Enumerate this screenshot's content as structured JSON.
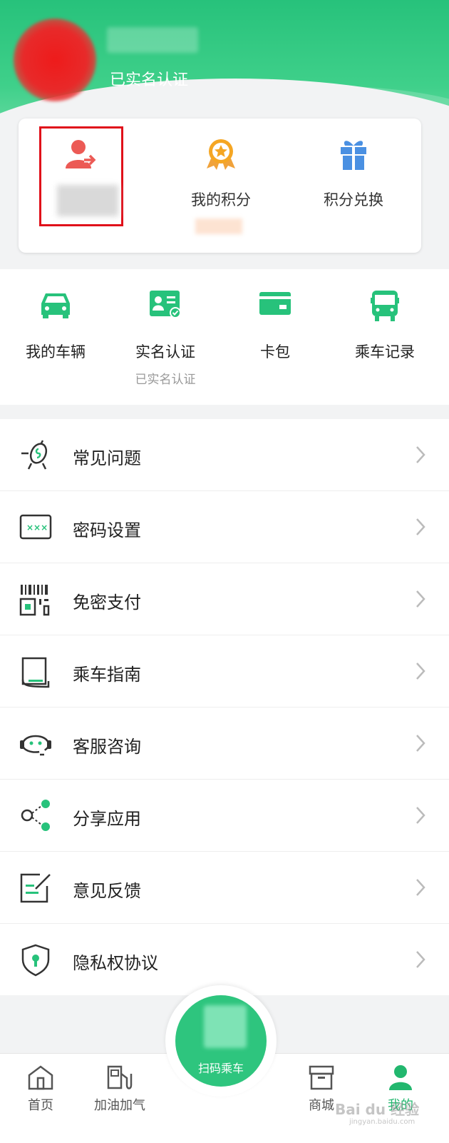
{
  "profile": {
    "verified_label": "已实名认证"
  },
  "card": {
    "items": [
      {
        "label": ""
      },
      {
        "label": "我的积分"
      },
      {
        "label": "积分兑换"
      }
    ]
  },
  "quick": {
    "items": [
      {
        "label": "我的车辆",
        "sub": ""
      },
      {
        "label": "实名认证",
        "sub": "已实名认证"
      },
      {
        "label": "卡包",
        "sub": ""
      },
      {
        "label": "乘车记录",
        "sub": ""
      }
    ]
  },
  "menu": {
    "items": [
      {
        "label": "常见问题",
        "icon": "faq-icon"
      },
      {
        "label": "密码设置",
        "icon": "password-icon"
      },
      {
        "label": "免密支付",
        "icon": "qrcode-pay-icon"
      },
      {
        "label": "乘车指南",
        "icon": "guide-book-icon"
      },
      {
        "label": "客服咨询",
        "icon": "customer-service-icon"
      },
      {
        "label": "分享应用",
        "icon": "share-icon"
      },
      {
        "label": "意见反馈",
        "icon": "feedback-icon"
      },
      {
        "label": "隐私权协议",
        "icon": "privacy-shield-icon"
      }
    ]
  },
  "tabbar": {
    "items": [
      {
        "label": "首页"
      },
      {
        "label": "加油加气"
      },
      {
        "label": "商城"
      },
      {
        "label": "我的"
      }
    ],
    "scan_label": "扫码乘车"
  },
  "watermark": {
    "text": "Bai du 经验",
    "sub": "jingyan.baidu.com"
  },
  "colors": {
    "brand_green": "#27c27b",
    "highlight_red": "#e0101a"
  }
}
